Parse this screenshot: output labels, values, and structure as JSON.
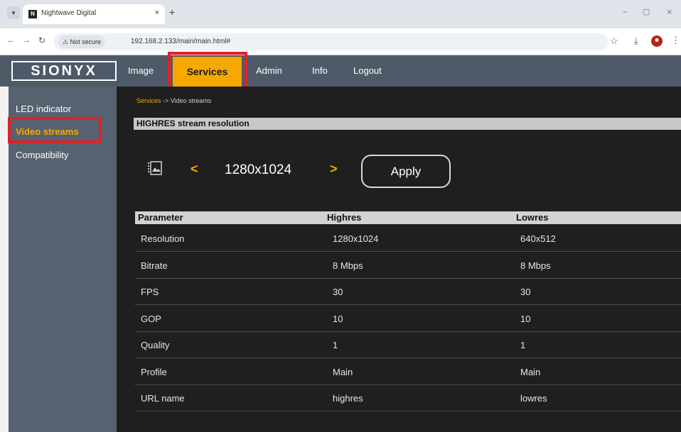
{
  "browser": {
    "tab_title": "Nightwave Digital",
    "tab_favicon": "N",
    "tab_close": "×",
    "new_tab": "+",
    "security": "⚠ Not secure",
    "url": "192.168.2.133/main/main.html#"
  },
  "app": {
    "logo": "SIONYX",
    "nav": [
      {
        "label": "Image"
      },
      {
        "label": "Services"
      },
      {
        "label": "Admin"
      },
      {
        "label": "Info"
      },
      {
        "label": "Logout"
      }
    ]
  },
  "sidebar": {
    "items": [
      {
        "label": "LED indicator"
      },
      {
        "label": "Video streams"
      },
      {
        "label": "Compatibility"
      }
    ]
  },
  "breadcrumb": {
    "parent": "Services",
    "separator": " -> ",
    "current": "Video streams"
  },
  "section": {
    "title": "HIGHRES stream resolution"
  },
  "selector": {
    "prev": "<",
    "next": ">",
    "value": "1280x1024",
    "apply": "Apply"
  },
  "table": {
    "headers": [
      "Parameter",
      "Highres",
      "Lowres"
    ],
    "rows": [
      [
        "Resolution",
        "1280x1024",
        "640x512"
      ],
      [
        "Bitrate",
        "8 Mbps",
        "8 Mbps"
      ],
      [
        "FPS",
        "30",
        "30"
      ],
      [
        "GOP",
        "10",
        "10"
      ],
      [
        "Quality",
        "1",
        "1"
      ],
      [
        "Profile",
        "Main",
        "Main"
      ],
      [
        "URL name",
        "highres",
        "lowres"
      ]
    ]
  },
  "colors": {
    "accent": "#f5a800",
    "highlight_box": "#e0202a",
    "header_bg": "#4e5a68",
    "content_bg": "#1f1f1f"
  },
  "icons": {
    "stream": "image-stack-icon"
  }
}
